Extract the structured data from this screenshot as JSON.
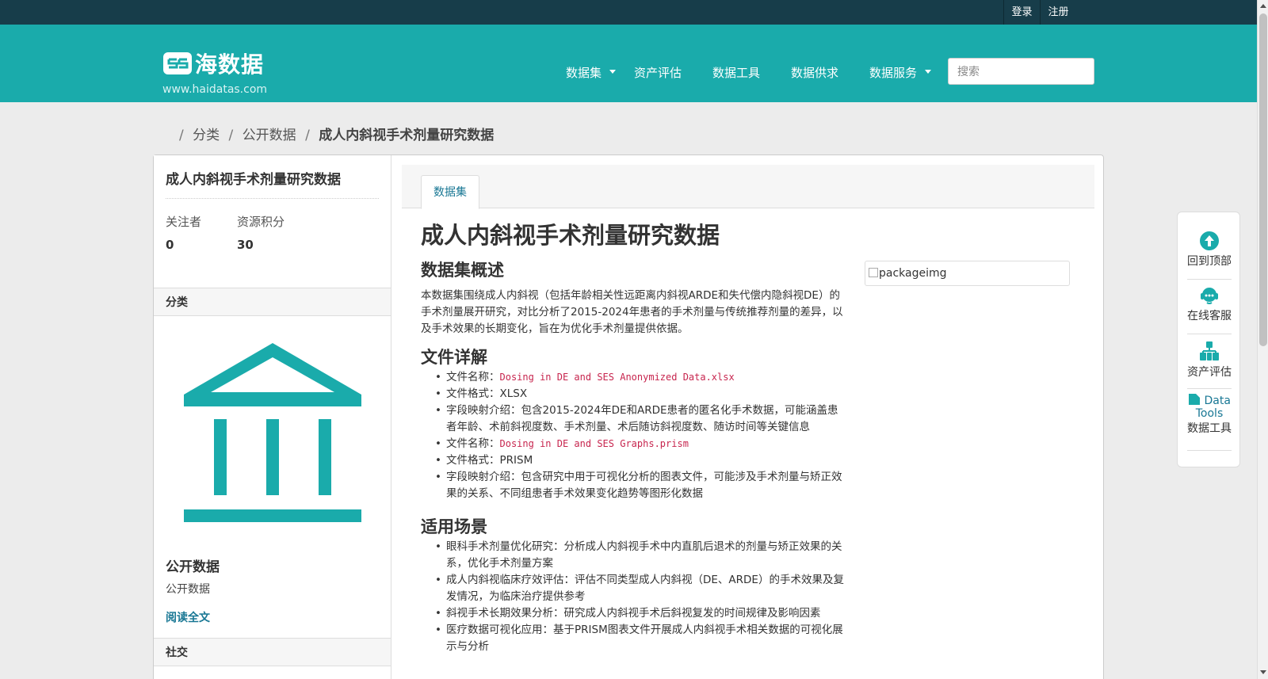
{
  "account": {
    "login": "登录",
    "register": "注册"
  },
  "masthead": {
    "logo_text": "海数据",
    "site_url": "www.haidatas.com",
    "nav": [
      {
        "label": "数据集",
        "dropdown": true
      },
      {
        "label": "资产评估",
        "dropdown": false
      },
      {
        "label": "数据工具",
        "dropdown": false
      },
      {
        "label": "数据供求",
        "dropdown": false
      },
      {
        "label": "数据服务",
        "dropdown": true
      }
    ],
    "search_placeholder": "搜索"
  },
  "breadcrumb": {
    "items": [
      "分类",
      "公开数据"
    ],
    "current": "成人内斜视手术剂量研究数据"
  },
  "sidebar": {
    "title": "成人内斜视手术剂量研究数据",
    "followers_label": "关注者",
    "followers_value": "0",
    "points_label": "资源积分",
    "points_value": "30",
    "category_header": "分类",
    "org_name": "公开数据",
    "org_desc": "公开数据",
    "read_more": "阅读全文",
    "social_header": "社交"
  },
  "content": {
    "tab_label": "数据集",
    "title": "成人内斜视手术剂量研究数据",
    "overview_heading": "数据集概述",
    "overview_text": "本数据集围绕成人内斜视（包括年龄相关性远距离内斜视ARDE和失代偿内隐斜视DE）的手术剂量展开研究，对比分析了2015-2024年患者的手术剂量与传统推荐剂量的差异，以及手术效果的长期变化，旨在为优化手术剂量提供依据。",
    "files_heading": "文件详解",
    "files": [
      {
        "prefix": "文件名称：",
        "code": "Dosing in DE and SES Anonymized Data.xlsx"
      },
      {
        "prefix": "文件格式：XLSX"
      },
      {
        "prefix": "字段映射介绍：包含2015-2024年DE和ARDE患者的匿名化手术数据，可能涵盖患者年龄、术前斜视度数、手术剂量、术后随访斜视度数、随访时间等关键信息"
      },
      {
        "prefix": "文件名称：",
        "code": "Dosing in DE and SES Graphs.prism"
      },
      {
        "prefix": "文件格式：PRISM"
      },
      {
        "prefix": "字段映射介绍：包含研究中用于可视化分析的图表文件，可能涉及手术剂量与矫正效果的关系、不同组患者手术效果变化趋势等图形化数据"
      }
    ],
    "usage_heading": "适用场景",
    "usage": [
      "眼科手术剂量优化研究：分析成人内斜视手术中内直肌后退术的剂量与矫正效果的关系，优化手术剂量方案",
      "成人内斜视临床疗效评估：评估不同类型成人内斜视（DE、ARDE）的手术效果及复发情况，为临床治疗提供参考",
      "斜视手术长期效果分析：研究成人内斜视手术后斜视复发的时间规律及影响因素",
      "医疗数据可视化应用：基于PRISM图表文件开展成人内斜视手术相关数据的可视化展示与分析"
    ],
    "package_img_alt": "packageimg"
  },
  "float_panel": {
    "back_to_top": "回到顶部",
    "online_service": "在线客服",
    "asset_eval": "资产评估",
    "data_tools_en": "Data Tools",
    "data_tools": "数据工具"
  },
  "colors": {
    "accent": "#1aabab",
    "topbar": "#173d4a",
    "link": "#187794",
    "code": "#c7254e"
  }
}
